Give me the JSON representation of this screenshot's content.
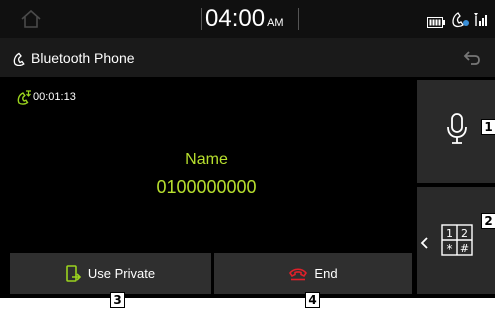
{
  "status_bar": {
    "time": "04:00",
    "ampm": "AM",
    "icons": [
      "home-icon",
      "battery-icon",
      "phone-status-icon",
      "signal-icon"
    ]
  },
  "title_bar": {
    "title": "Bluetooth Phone",
    "icons": [
      "phone-icon",
      "back-icon"
    ]
  },
  "call": {
    "duration": "00:01:13",
    "name": "Name",
    "number": "0100000000"
  },
  "side_buttons": {
    "mute_icon": "microphone-icon",
    "keypad_icon": "keypad-icon",
    "keypad_keys": [
      "1",
      "2",
      "*",
      "#"
    ]
  },
  "bottom_buttons": {
    "private_label": "Use Private",
    "end_label": "End"
  },
  "callouts": [
    "1",
    "2",
    "3",
    "4"
  ],
  "colors": {
    "accent_green": "#b8e02e",
    "end_red": "#e0202a",
    "private_green": "#9bd41e",
    "button_bg": "#2f2f2f"
  }
}
